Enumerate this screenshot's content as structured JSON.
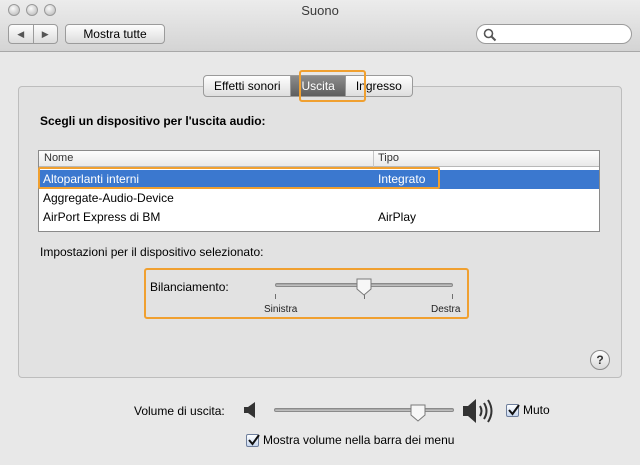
{
  "window": {
    "title": "Suono"
  },
  "toolbar": {
    "back_label": "◀",
    "forward_label": "▶",
    "show_all_label": "Mostra tutte",
    "search_value": ""
  },
  "tabs": [
    {
      "label": "Effetti sonori",
      "active": false
    },
    {
      "label": "Uscita",
      "active": true
    },
    {
      "label": "Ingresso",
      "active": false
    }
  ],
  "output": {
    "heading": "Scegli un dispositivo per l'uscita audio:",
    "columns": {
      "name": "Nome",
      "type": "Tipo"
    },
    "devices": [
      {
        "name": "Altoparlanti interni",
        "type": "Integrato",
        "selected": true
      },
      {
        "name": "Aggregate-Audio-Device",
        "type": "",
        "selected": false
      },
      {
        "name": "AirPort Express di BM",
        "type": "AirPlay",
        "selected": false
      }
    ],
    "settings_label": "Impostazioni per il dispositivo selezionato:",
    "balance": {
      "label": "Bilanciamento:",
      "left_label": "Sinistra",
      "right_label": "Destra",
      "value": 0.5
    }
  },
  "help": {
    "label": "?"
  },
  "footer": {
    "volume_label": "Volume di uscita:",
    "volume_value": 0.8,
    "mute": {
      "label": "Muto",
      "checked": true
    },
    "show_in_menubar": {
      "label": "Mostra volume nella barra dei menu",
      "checked": true
    }
  },
  "colors": {
    "highlight": "#f0a030",
    "selection": "#3b78cf"
  },
  "icons": [
    "back-arrow-icon",
    "forward-arrow-icon",
    "search-icon",
    "speaker-low-icon",
    "speaker-high-icon",
    "checkmark-icon"
  ]
}
